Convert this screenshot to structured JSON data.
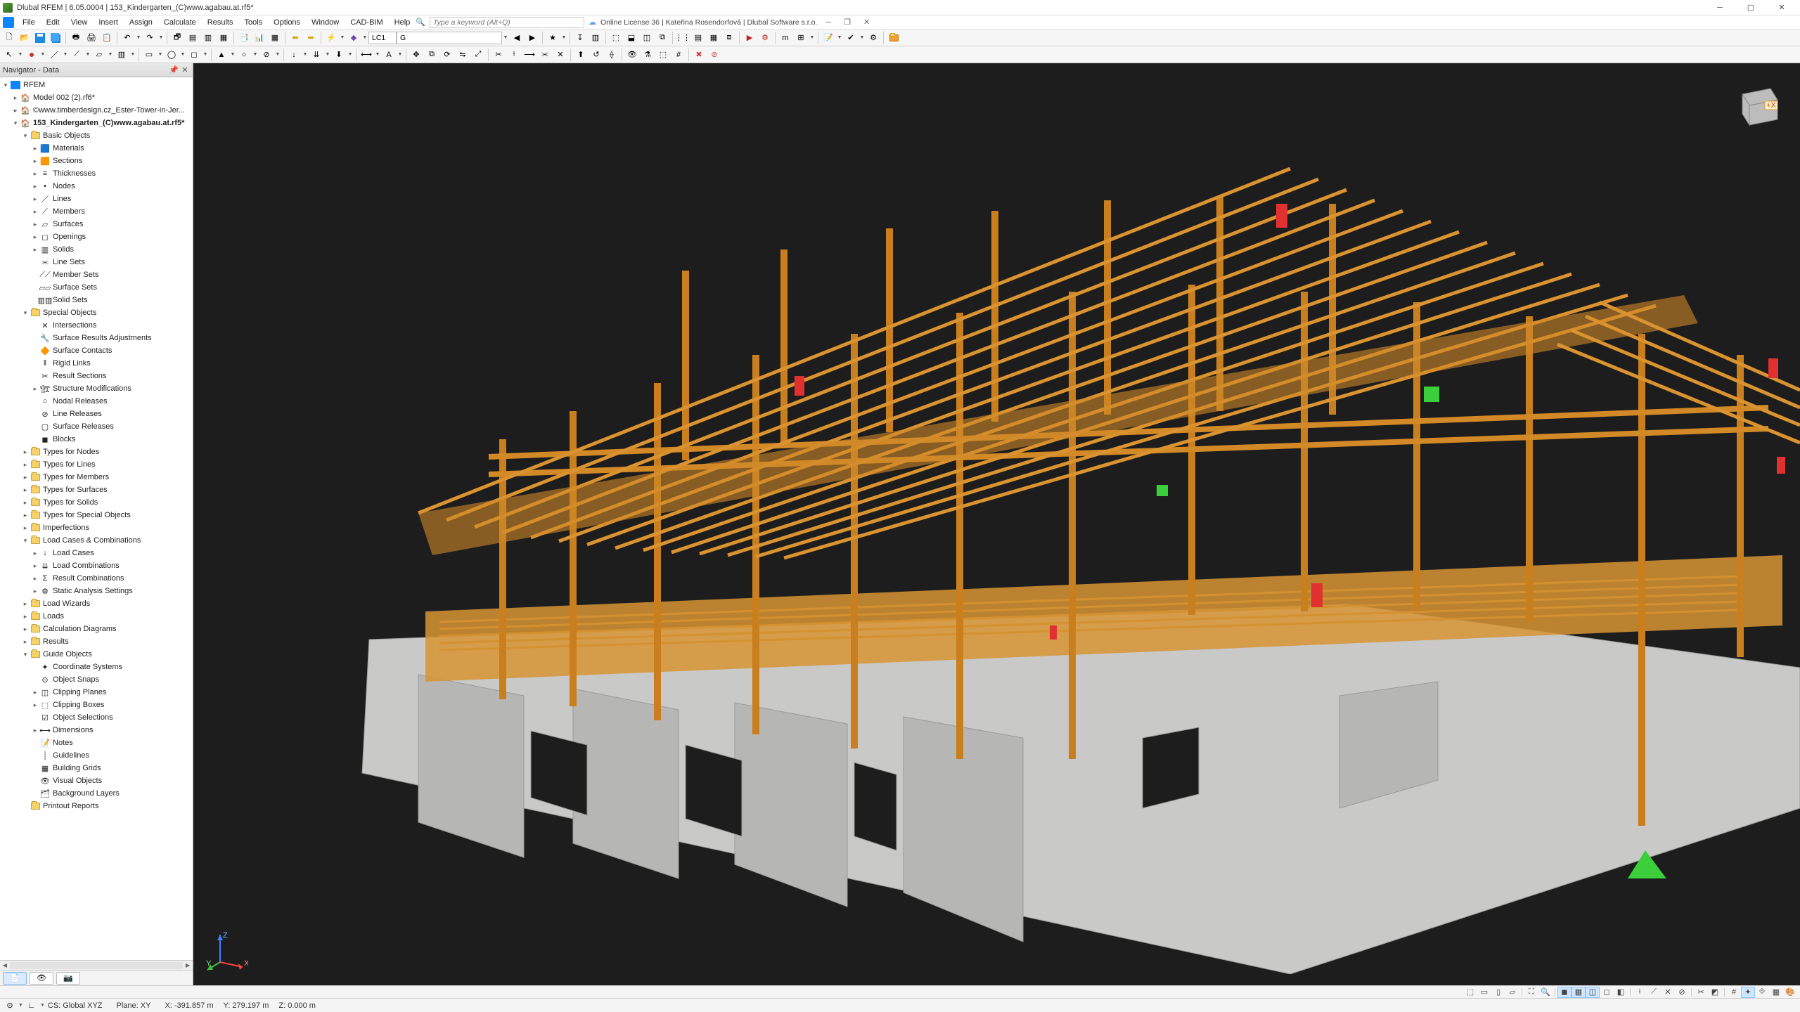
{
  "title": "Dlubal RFEM | 6.05.0004 | 153_Kindergarten_(C)www.agabau.at.rf5*",
  "license": "Online License 36 | Kateřina Rosendorfová | Dlubal Software s.r.o.",
  "search_placeholder": "Type a keyword (Alt+Q)",
  "menu": [
    "File",
    "Edit",
    "View",
    "Insert",
    "Assign",
    "Calculate",
    "Results",
    "Tools",
    "Options",
    "Window",
    "CAD-BIM",
    "Help"
  ],
  "loadcase": {
    "lc": "LC1",
    "desc": "G"
  },
  "navigator": {
    "title": "Navigator - Data",
    "root": "RFEM",
    "models": [
      "Model 002 (2).rf6*",
      "©www.timberdesign.cz_Ester-Tower-in-Jer...",
      "153_Kindergarten_(C)www.agabau.at.rf5*"
    ],
    "basic": "Basic Objects",
    "basic_items": [
      "Materials",
      "Sections",
      "Thicknesses",
      "Nodes",
      "Lines",
      "Members",
      "Surfaces",
      "Openings",
      "Solids",
      "Line Sets",
      "Member Sets",
      "Surface Sets",
      "Solid Sets"
    ],
    "special": "Special Objects",
    "special_items": [
      "Intersections",
      "Surface Results Adjustments",
      "Surface Contacts",
      "Rigid Links",
      "Result Sections",
      "Structure Modifications",
      "Nodal Releases",
      "Line Releases",
      "Surface Releases",
      "Blocks"
    ],
    "types": [
      "Types for Nodes",
      "Types for Lines",
      "Types for Members",
      "Types for Surfaces",
      "Types for Solids",
      "Types for Special Objects",
      "Imperfections"
    ],
    "loadcomb": "Load Cases & Combinations",
    "loadcomb_items": [
      "Load Cases",
      "Load Combinations",
      "Result Combinations",
      "Static Analysis Settings"
    ],
    "after": [
      "Load Wizards",
      "Loads",
      "Calculation Diagrams",
      "Results"
    ],
    "guide": "Guide Objects",
    "guide_items": [
      "Coordinate Systems",
      "Object Snaps",
      "Clipping Planes",
      "Clipping Boxes",
      "Object Selections",
      "Dimensions",
      "Notes",
      "Guidelines",
      "Building Grids",
      "Visual Objects",
      "Background Layers"
    ],
    "last": "Printout Reports"
  },
  "status": {
    "cs": "CS: Global XYZ",
    "plane": "Plane: XY",
    "x": "X: -391.857 m",
    "y": "Y: 279.197 m",
    "z": "Z: 0.000 m"
  }
}
